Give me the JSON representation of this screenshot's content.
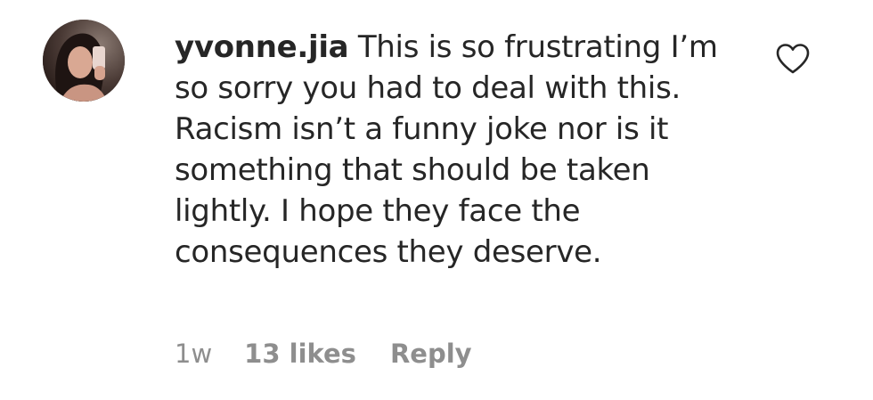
{
  "comment": {
    "username": "yvonne.jia",
    "text": "This is so frustrating I’m so sorry you had to deal with this. Racism isn’t a funny joke nor is it something that should be taken lightly. I hope they face the consequences they deserve.",
    "time": "1w",
    "likes": "13 likes",
    "reply_label": "Reply",
    "avatar_icon": "profile-photo",
    "like_icon": "heart-outline-icon"
  }
}
